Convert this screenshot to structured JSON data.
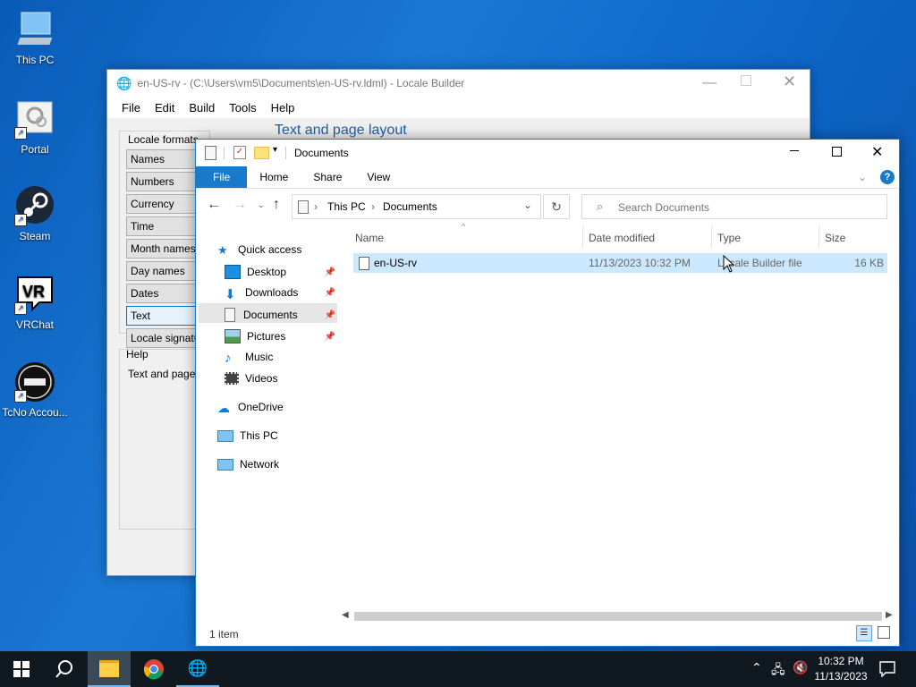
{
  "desktop": {
    "icons": [
      {
        "label": "This PC"
      },
      {
        "label": "Portal"
      },
      {
        "label": "Steam"
      },
      {
        "label": "VRChat"
      },
      {
        "label": "TcNo Accou..."
      }
    ]
  },
  "locale_builder": {
    "title": "en-US-rv - (C:\\Users\\vm5\\Documents\\en-US-rv.ldml) - Locale Builder",
    "menu": [
      "File",
      "Edit",
      "Build",
      "Tools",
      "Help"
    ],
    "section_title": "Text and page layout",
    "group_label": "Locale formats",
    "format_buttons": [
      "Names",
      "Numbers",
      "Currency",
      "Time",
      "Month names",
      "Day names",
      "Dates",
      "Text",
      "Locale signatu"
    ],
    "selected_format": "Text",
    "help_label": "Help",
    "help_text": "Text and page"
  },
  "explorer": {
    "title": "Documents",
    "ribbon_tabs": [
      "File",
      "Home",
      "Share",
      "View"
    ],
    "address": {
      "parts": [
        "This PC",
        "Documents"
      ]
    },
    "search": {
      "placeholder": "Search Documents"
    },
    "nav": {
      "quick_access": "Quick access",
      "items": [
        "Desktop",
        "Downloads",
        "Documents",
        "Pictures",
        "Music",
        "Videos"
      ],
      "onedrive": "OneDrive",
      "this_pc": "This PC",
      "network": "Network"
    },
    "columns": [
      "Name",
      "Date modified",
      "Type",
      "Size"
    ],
    "files": [
      {
        "name": "en-US-rv",
        "date": "11/13/2023 10:32 PM",
        "type": "Locale Builder file",
        "size": "16 KB"
      }
    ],
    "status": "1 item"
  },
  "taskbar": {
    "time": "10:32 PM",
    "date": "11/13/2023"
  },
  "colors": {
    "accent": "#1979ca",
    "selection": "#cce8ff",
    "file_tab": "#1979ca"
  }
}
